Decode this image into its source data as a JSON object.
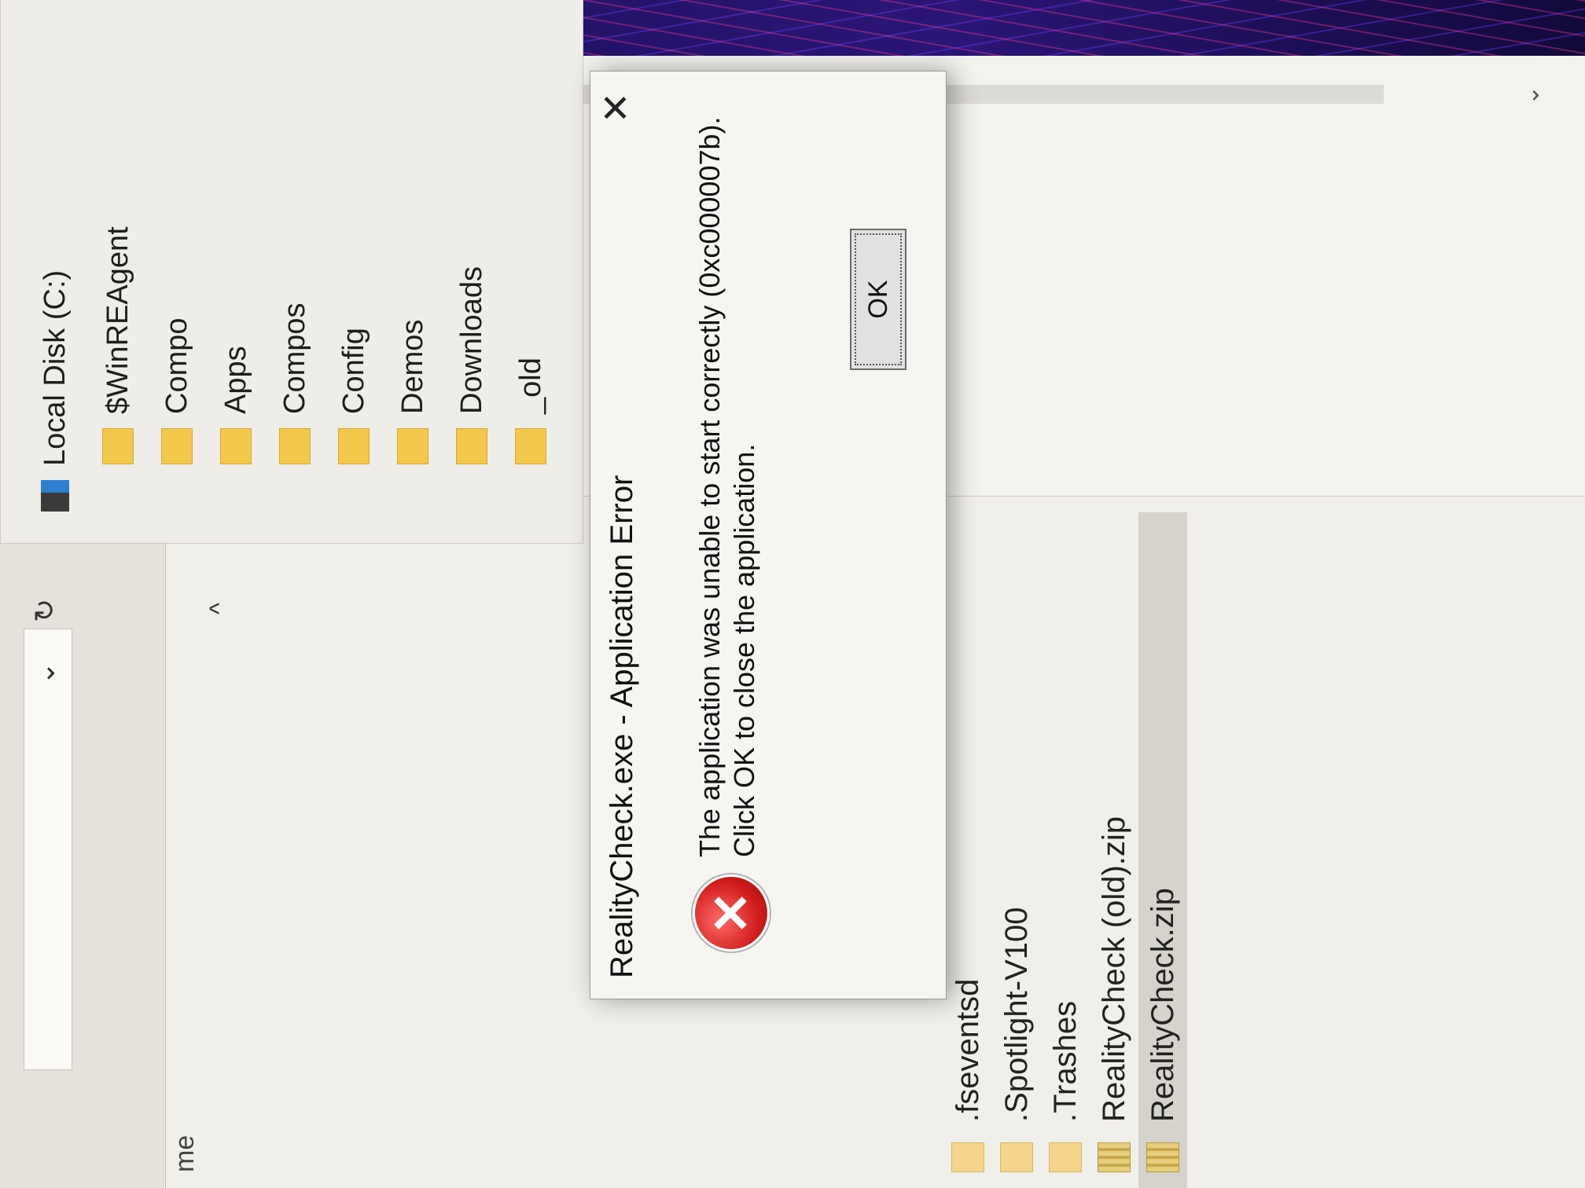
{
  "explorer": {
    "column_header": "me",
    "files": [
      {
        "name": ".fseventsd",
        "type": "folder"
      },
      {
        "name": ".Spotlight-V100",
        "type": "folder"
      },
      {
        "name": ".Trashes",
        "type": "folder"
      },
      {
        "name": "RealityCheck (old).zip",
        "type": "zip"
      },
      {
        "name": "RealityCheck.zip",
        "type": "zip",
        "selected": true
      }
    ]
  },
  "tree": {
    "drive_label": "Local Disk (C:)",
    "items": [
      "$WinREAgent",
      "Compo",
      "Apps",
      "Compos",
      "Config",
      "Demos",
      "Downloads",
      "_old"
    ]
  },
  "dialog": {
    "title": "RealityCheck.exe - Application Error",
    "message_line1": "The application was unable to start correctly (0xc000007b).",
    "message_line2": "Click OK to close the application.",
    "ok_label": "OK",
    "close_glyph": "✕",
    "error_glyph": "✕"
  },
  "icons": {
    "dropdown": "⌄",
    "refresh": "↻",
    "up_chevron": "^",
    "scroll_up": "^",
    "scroll_down": "⌄"
  },
  "colors": {
    "error_red": "#d11b1b",
    "folder_yellow": "#f2c94c",
    "wallpaper_purple": "#2b1577"
  }
}
